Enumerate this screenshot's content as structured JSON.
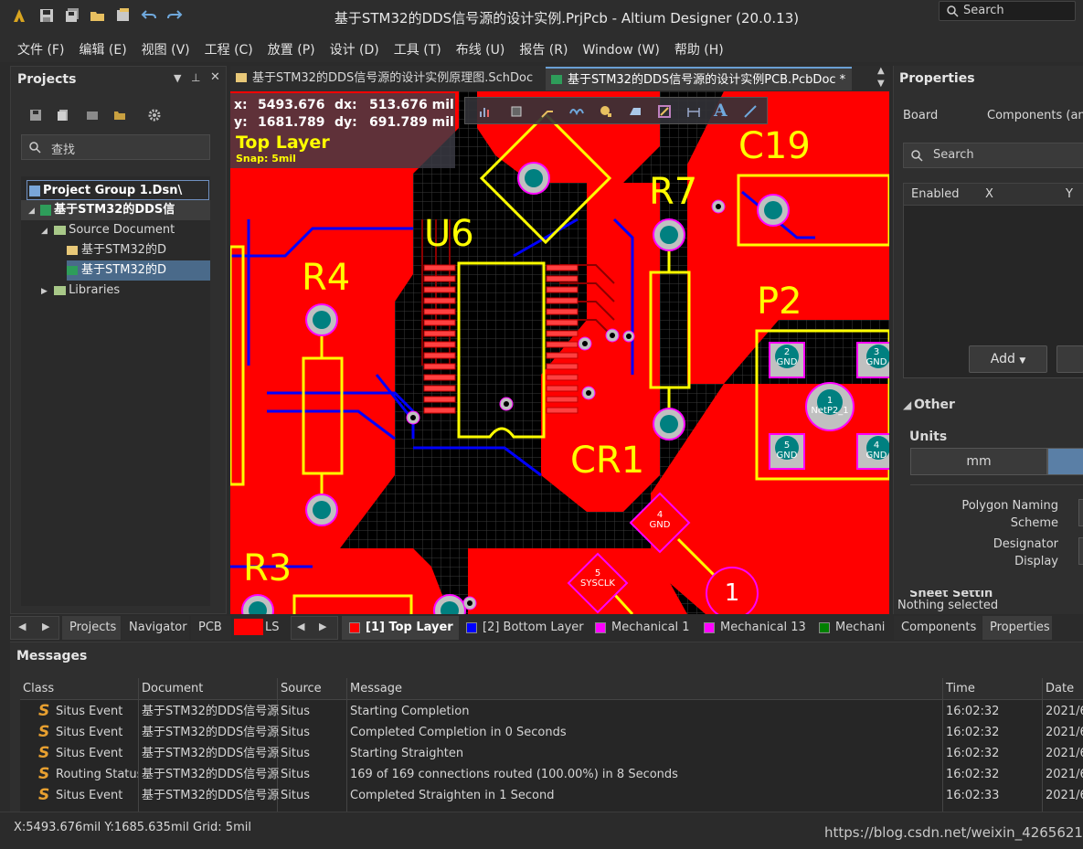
{
  "window": {
    "title": "基于STM32的DDS信号源的设计实例.PrjPcb - Altium Designer (20.0.13)",
    "search_placeholder": "Search"
  },
  "menu": [
    "文件 (F)",
    "编辑 (E)",
    "视图 (V)",
    "工程 (C)",
    "放置 (P)",
    "设计 (D)",
    "工具 (T)",
    "布线 (U)",
    "报告 (R)",
    "Window (W)",
    "帮助 (H)"
  ],
  "projects_panel": {
    "title": "Projects",
    "search_placeholder": "查找",
    "tree": {
      "group": "Project Group 1.Dsn\\",
      "project": "基于STM32的DDS信",
      "source_folder": "Source Document",
      "schematic": "基于STM32的D",
      "pcb": "基于STM32的D",
      "libraries": "Libraries"
    },
    "bottom_tabs": [
      "Projects",
      "Navigator",
      "PCB",
      "LS"
    ]
  },
  "doc_tabs": [
    {
      "label": "基于STM32的DDS信号源的设计实例原理图.SchDoc",
      "active": false
    },
    {
      "label": "基于STM32的DDS信号源的设计实例PCB.PcbDoc *",
      "active": true
    }
  ],
  "pcb_overlay": {
    "x_label": "x:",
    "x_value": "5493.676",
    "dx_label": "dx:",
    "dx_value": "513.676 mil",
    "y_label": "y:",
    "y_value": "1681.789",
    "dy_label": "dy:",
    "dy_value": "691.789 mil",
    "layer": "Top Layer",
    "snap": "Snap: 5mil"
  },
  "pcb_designators": [
    "C19",
    "R7",
    "U6",
    "R4",
    "P2",
    "CR1",
    "R3"
  ],
  "pcb_pad_labels": {
    "p2_pad2": "2",
    "p2_pad2_net": "GND",
    "p2_pad3": "3",
    "p2_pad3_net": "GND",
    "p2_pad1": "1",
    "p2_pad1_net": "NetP2_1",
    "p2_pad5": "5",
    "p2_pad5_net": "GND",
    "p2_pad4": "4",
    "p2_pad4_net": "GND",
    "cr1_pad4": "4",
    "cr1_pad4_net": "GND",
    "cr1_pad5": "5",
    "cr1_pad5_net": "SYSCLK",
    "big_pad": "1"
  },
  "layer_tabs": [
    {
      "label": "[1] Top Layer",
      "color": "#ff0000",
      "active": true
    },
    {
      "label": "[2] Bottom Layer",
      "color": "#0000ff",
      "active": false
    },
    {
      "label": "Mechanical 1",
      "color": "#ff00ff",
      "active": false
    },
    {
      "label": "Mechanical 13",
      "color": "#ff00ff",
      "active": false
    },
    {
      "label": "Mechani",
      "color": "#008000",
      "active": false
    }
  ],
  "properties_panel": {
    "title": "Properties",
    "board_label": "Board",
    "components_label": "Components (and",
    "search_placeholder": "Search",
    "columns": [
      "Enabled",
      "X",
      "Y"
    ],
    "add_button": "Add",
    "other_section": "Other",
    "units_label": "Units",
    "units_mm": "mm",
    "polygon_naming_label": "Polygon Naming Scheme",
    "designator_display_label": "Designator Display",
    "cut_off_label": "Sheet Settin",
    "status": "Nothing selected",
    "bottom_tabs": [
      "Components",
      "Properties"
    ]
  },
  "messages_panel": {
    "title": "Messages",
    "columns": [
      "Class",
      "Document",
      "Source",
      "Message",
      "Time",
      "Date"
    ],
    "rows": [
      {
        "class": "Situs Event",
        "document": "基于STM32的DDS信号源",
        "source": "Situs",
        "message": "Starting Completion",
        "time": "16:02:32",
        "date": "2021/6"
      },
      {
        "class": "Situs Event",
        "document": "基于STM32的DDS信号源",
        "source": "Situs",
        "message": "Completed Completion in 0 Seconds",
        "time": "16:02:32",
        "date": "2021/6"
      },
      {
        "class": "Situs Event",
        "document": "基于STM32的DDS信号源",
        "source": "Situs",
        "message": "Starting Straighten",
        "time": "16:02:32",
        "date": "2021/6"
      },
      {
        "class": "Routing Status",
        "document": "基于STM32的DDS信号源",
        "source": "Situs",
        "message": "169 of 169 connections routed (100.00%) in 8 Seconds",
        "time": "16:02:32",
        "date": "2021/6"
      },
      {
        "class": "Situs Event",
        "document": "基于STM32的DDS信号源",
        "source": "Situs",
        "message": "Completed Straighten in 1 Second",
        "time": "16:02:33",
        "date": "2021/6"
      }
    ]
  },
  "status_bar": {
    "coords": "X:5493.676mil Y:1685.635mil",
    "grid": "Grid: 5mil",
    "watermark": "https://blog.csdn.net/weixin_42656213"
  },
  "colors": {
    "top_layer": "#ff0000",
    "bottom_layer": "#0000ff",
    "silkscreen": "#ffff00",
    "pad": "#c0c0c0",
    "via_hole": "#008080",
    "board_bg": "#000000"
  }
}
